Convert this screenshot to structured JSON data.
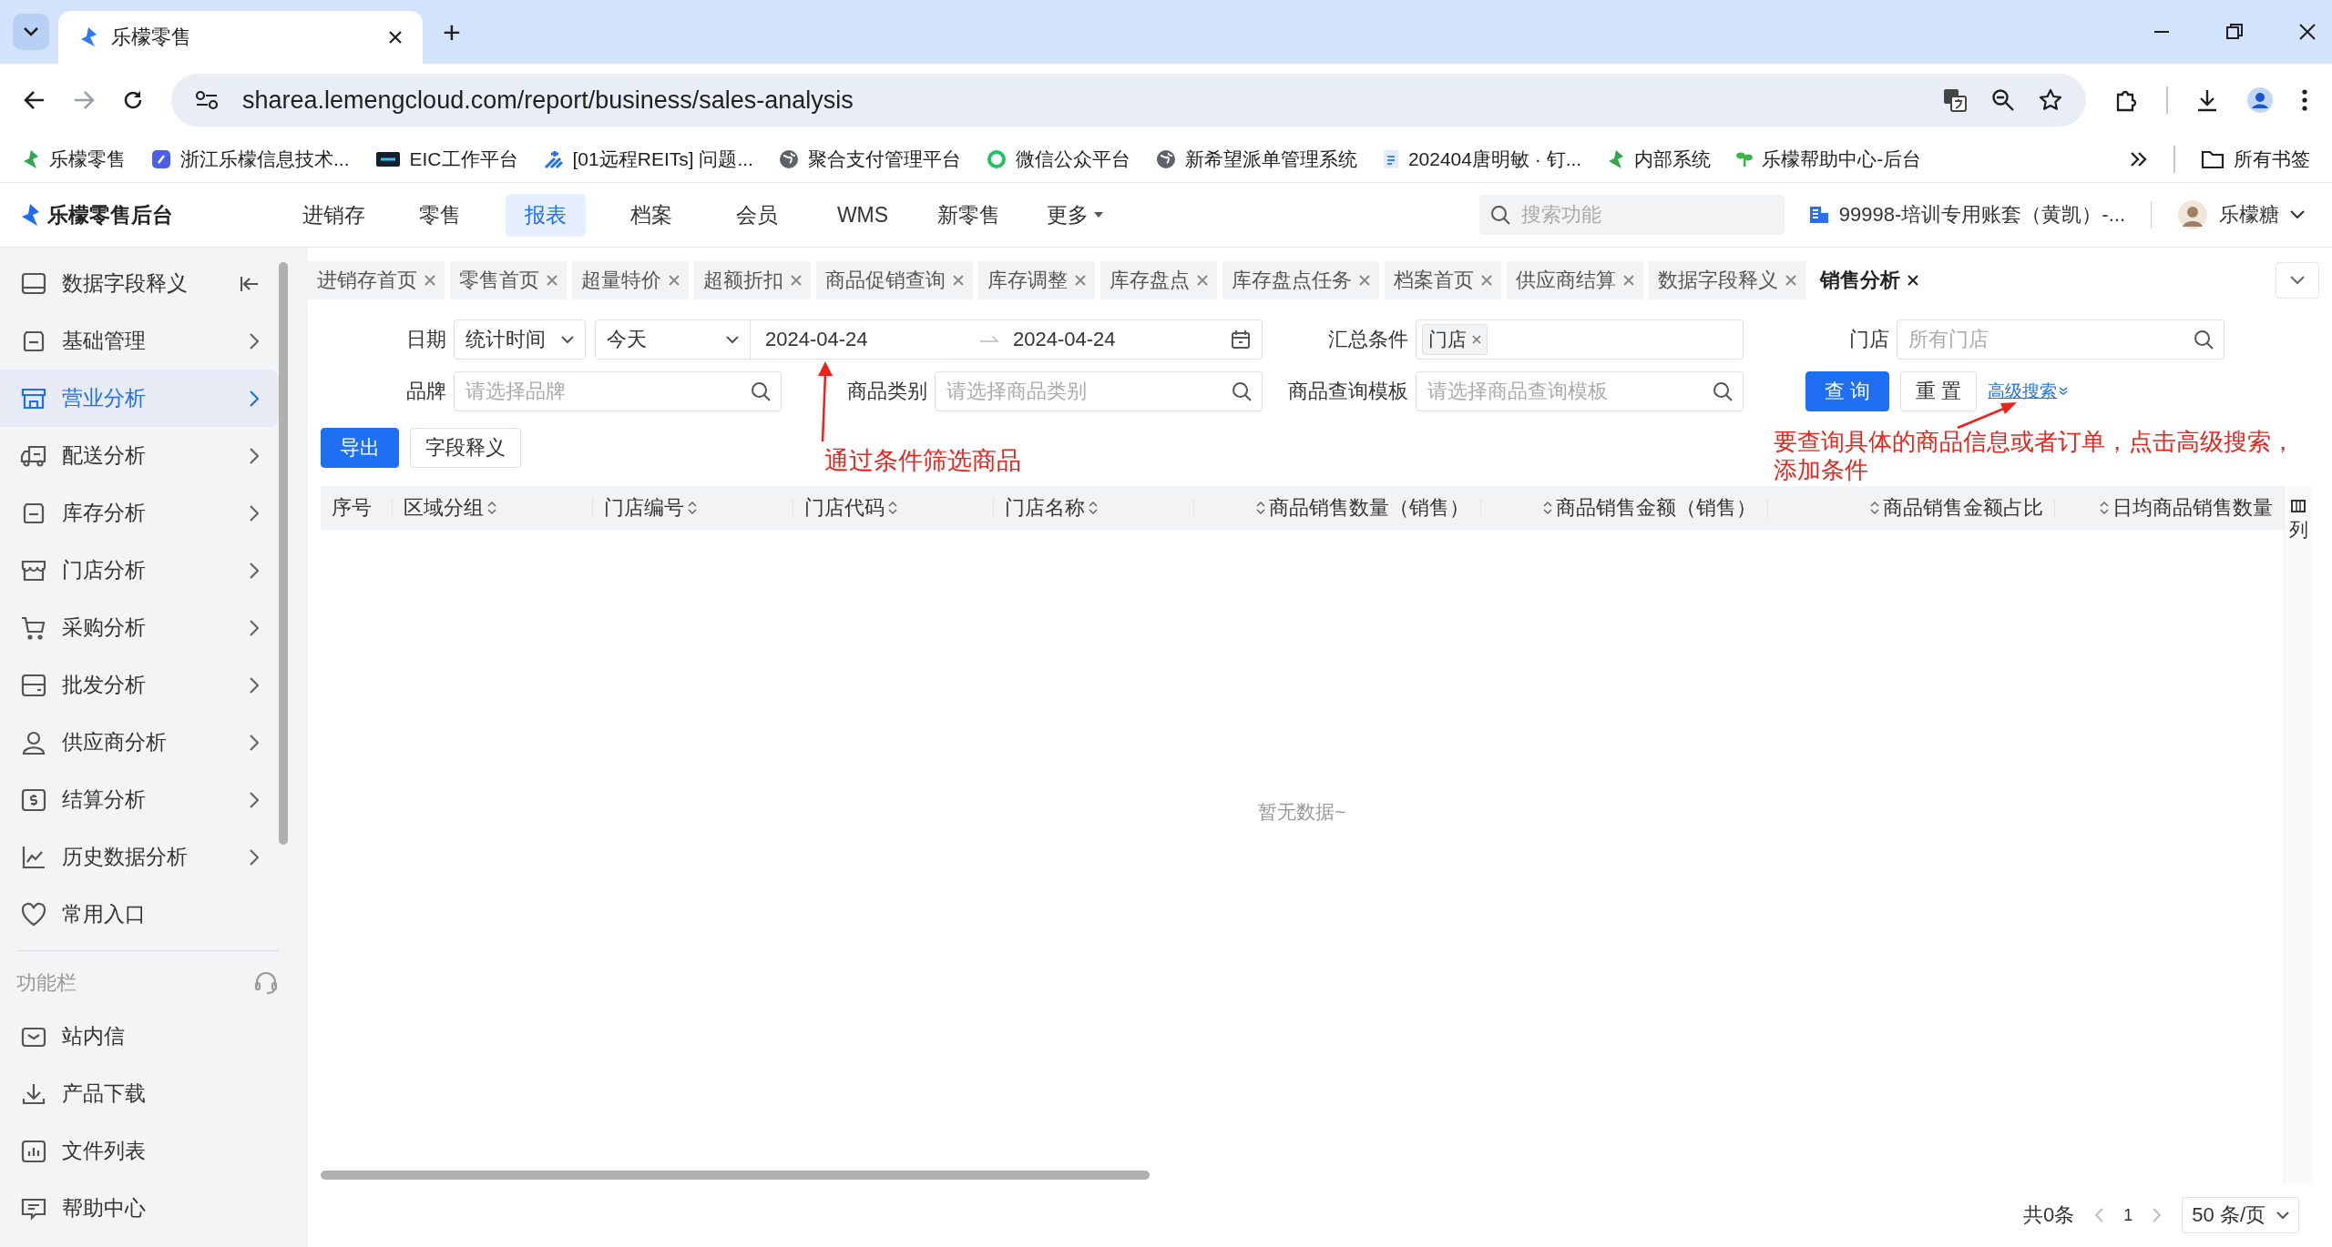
{
  "browser": {
    "tabs": [
      {
        "title": "乐檬零售",
        "selected": true
      }
    ],
    "new_tab": "+",
    "url": "sharea.lemengcloud.com/report/business/sales-analysis",
    "bookmarks": [
      {
        "label": "乐檬零售"
      },
      {
        "label": "浙江乐檬信息技术..."
      },
      {
        "label": "EIC工作平台"
      },
      {
        "label": "[01远程REITs] 问题..."
      },
      {
        "label": "聚合支付管理平台"
      },
      {
        "label": "微信公众平台"
      },
      {
        "label": "新希望派单管理系统"
      },
      {
        "label": "202404唐明敏 · 钉..."
      },
      {
        "label": "内部系统"
      },
      {
        "label": "乐檬帮助中心-后台"
      }
    ],
    "all_bookmarks": "所有书签"
  },
  "app": {
    "logo": "乐檬零售后台",
    "nav": [
      {
        "label": "进销存",
        "selected": false,
        "dropdown": false
      },
      {
        "label": "零售",
        "selected": false,
        "dropdown": false
      },
      {
        "label": "报表",
        "selected": true,
        "dropdown": false
      },
      {
        "label": "档案",
        "selected": false,
        "dropdown": false
      },
      {
        "label": "会员",
        "selected": false,
        "dropdown": false
      },
      {
        "label": "WMS",
        "selected": false,
        "dropdown": false
      },
      {
        "label": "新零售",
        "selected": false,
        "dropdown": false
      },
      {
        "label": "更多",
        "selected": false,
        "dropdown": true
      }
    ],
    "search_placeholder": "搜索功能",
    "account": "99998-培训专用账套（黄凯）-...",
    "user": "乐檬糖"
  },
  "page_tabs": [
    {
      "label": "进销存首页",
      "selected": false
    },
    {
      "label": "零售首页",
      "selected": false
    },
    {
      "label": "超量特价",
      "selected": false
    },
    {
      "label": "超额折扣",
      "selected": false
    },
    {
      "label": "商品促销查询",
      "selected": false
    },
    {
      "label": "库存调整",
      "selected": false
    },
    {
      "label": "库存盘点",
      "selected": false
    },
    {
      "label": "库存盘点任务",
      "selected": false
    },
    {
      "label": "档案首页",
      "selected": false
    },
    {
      "label": "供应商结算",
      "selected": false
    },
    {
      "label": "数据字段释义",
      "selected": false
    },
    {
      "label": "销售分析",
      "selected": true
    }
  ],
  "sidebar": {
    "items": [
      {
        "label": "数据字段释义",
        "kind": "collapse",
        "selected": false
      },
      {
        "label": "基础管理",
        "kind": "group",
        "selected": false
      },
      {
        "label": "营业分析",
        "kind": "group",
        "selected": true
      },
      {
        "label": "配送分析",
        "kind": "group",
        "selected": false
      },
      {
        "label": "库存分析",
        "kind": "group",
        "selected": false
      },
      {
        "label": "门店分析",
        "kind": "group",
        "selected": false
      },
      {
        "label": "采购分析",
        "kind": "group",
        "selected": false
      },
      {
        "label": "批发分析",
        "kind": "group",
        "selected": false
      },
      {
        "label": "供应商分析",
        "kind": "group",
        "selected": false
      },
      {
        "label": "结算分析",
        "kind": "group",
        "selected": false
      },
      {
        "label": "历史数据分析",
        "kind": "group",
        "selected": false
      },
      {
        "label": "常用入口",
        "kind": "link",
        "selected": false
      }
    ],
    "section_title": "功能栏",
    "tools": [
      {
        "label": "站内信"
      },
      {
        "label": "产品下载"
      },
      {
        "label": "文件列表"
      },
      {
        "label": "帮助中心"
      }
    ]
  },
  "filters": {
    "date_label": "日期",
    "date_type": "统计时间",
    "date_preset": "今天",
    "date_start": "2024-04-24",
    "date_end": "2024-04-24",
    "summary_label": "汇总条件",
    "summary_tags": [
      "门店"
    ],
    "store_label": "门店",
    "store_placeholder": "所有门店",
    "brand_label": "品牌",
    "brand_placeholder": "请选择品牌",
    "category_label": "商品类别",
    "category_placeholder": "请选择商品类别",
    "template_label": "商品查询模板",
    "template_placeholder": "请选择商品查询模板",
    "query_button": "查 询",
    "reset_button": "重 置",
    "advanced_link": "高级搜索"
  },
  "actions": [
    "导出",
    "字段释义"
  ],
  "annotations": [
    "通过条件筛选商品",
    "要查询具体的商品信息或者订单，点击高级搜索，添加条件"
  ],
  "table": {
    "columns": [
      {
        "label": "序号",
        "sortable": false,
        "numeric": false
      },
      {
        "label": "区域分组",
        "sortable": true,
        "numeric": false
      },
      {
        "label": "门店编号",
        "sortable": true,
        "numeric": false
      },
      {
        "label": "门店代码",
        "sortable": true,
        "numeric": false
      },
      {
        "label": "门店名称",
        "sortable": true,
        "numeric": false
      },
      {
        "label": "商品销售数量（销售）",
        "sortable": true,
        "numeric": true
      },
      {
        "label": "商品销售金额（销售）",
        "sortable": true,
        "numeric": true
      },
      {
        "label": "商品销售金额占比",
        "sortable": true,
        "numeric": true
      },
      {
        "label": "日均商品销售数量",
        "sortable": true,
        "numeric": true
      }
    ],
    "column_settings": "列",
    "empty_text": "暂无数据~"
  },
  "pagination": {
    "total": "共0条",
    "page": "1",
    "page_size": "50 条/页"
  }
}
